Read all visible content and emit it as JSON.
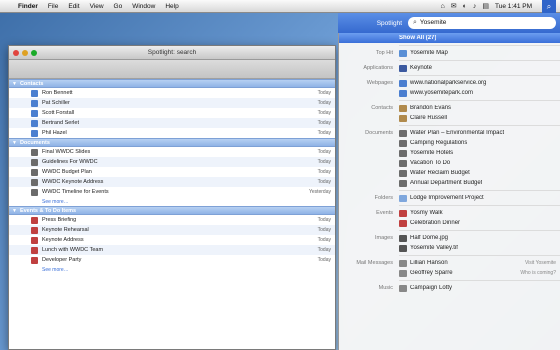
{
  "menubar": {
    "apple": "",
    "items": [
      "Finder",
      "File",
      "Edit",
      "View",
      "Go",
      "Window",
      "Help"
    ],
    "clock": "Tue 1:41 PM",
    "tray": [
      "⌂",
      "✉",
      "◐",
      "♪",
      "▤"
    ]
  },
  "spotlight": {
    "label": "Spotlight",
    "query": "Yosemite",
    "show_all": "Show All (27)",
    "groups": [
      {
        "category": "Top Hit",
        "items": [
          {
            "text": "Yosemite Map",
            "color": "#5a8fd6"
          }
        ]
      },
      {
        "category": "Applications",
        "items": [
          {
            "text": "Keynote",
            "color": "#3c5aa0"
          }
        ]
      },
      {
        "category": "Webpages",
        "items": [
          {
            "text": "www.nationalparkservice.org",
            "color": "#4b7fd0"
          },
          {
            "text": "www.yosemitepark.com",
            "color": "#4b7fd0"
          }
        ]
      },
      {
        "category": "Contacts",
        "items": [
          {
            "text": "Brandon Evans",
            "color": "#b08a4c"
          },
          {
            "text": "Claire Russell",
            "color": "#b08a4c"
          }
        ]
      },
      {
        "category": "Documents",
        "items": [
          {
            "text": "Water Plan – Environmental Impact",
            "color": "#6b6b6b"
          },
          {
            "text": "Camping Regulations",
            "color": "#6b6b6b"
          },
          {
            "text": "Yosemite Hotels",
            "color": "#6b6b6b"
          },
          {
            "text": "Vacation To Do",
            "color": "#6b6b6b"
          },
          {
            "text": "Water Reclaim Budget",
            "color": "#6b6b6b"
          },
          {
            "text": "Annual Department Budget",
            "color": "#6b6b6b"
          }
        ]
      },
      {
        "category": "Folders",
        "items": [
          {
            "text": "Lodge Improvement Project",
            "color": "#7fa7dd"
          }
        ]
      },
      {
        "category": "Events",
        "items": [
          {
            "text": "Yosmy Walk",
            "color": "#c04040"
          },
          {
            "text": "Celebration Dinner",
            "color": "#c04040"
          }
        ]
      },
      {
        "category": "Images",
        "items": [
          {
            "text": "Half Dome.jpg",
            "color": "#555"
          },
          {
            "text": "Yosemite Valley.tif",
            "color": "#555"
          }
        ]
      },
      {
        "category": "Mail Messages",
        "items": [
          {
            "text": "Lillian Hanson",
            "color": "#888",
            "meta": "Visit Yosemite"
          },
          {
            "text": "Geoffrey Sparre",
            "color": "#888",
            "meta": "Who is coming?"
          }
        ]
      },
      {
        "category": "Music",
        "items": [
          {
            "text": "Campaign Lotty",
            "color": "#888"
          }
        ]
      }
    ]
  },
  "window": {
    "title": "Spotlight: search",
    "groups": [
      {
        "name": "Contacts",
        "color": "#4b7fd0",
        "rows": [
          {
            "name": "Ron Bennett",
            "date": "Today"
          },
          {
            "name": "Pat Schiller",
            "date": "Today"
          },
          {
            "name": "Scott Forstall",
            "date": "Today"
          },
          {
            "name": "Bertrand Serlet",
            "date": "Today"
          },
          {
            "name": "Phil Hazel",
            "date": "Today"
          }
        ]
      },
      {
        "name": "Documents",
        "color": "#6b6b6b",
        "rows": [
          {
            "name": "Final WWDC Slides",
            "date": "Today"
          },
          {
            "name": "Guidelines For WWDC",
            "date": "Today"
          },
          {
            "name": "WWDC Budget Plan",
            "date": "Today"
          },
          {
            "name": "WWDC Keynote Address",
            "date": "Today"
          },
          {
            "name": "WWDC Timeline for Events",
            "date": "Yesterday"
          }
        ],
        "more": "See more…"
      },
      {
        "name": "Events & To Do Items",
        "color": "#c04040",
        "rows": [
          {
            "name": "Press Briefing",
            "date": "Today"
          },
          {
            "name": "Keynote Rehearsal",
            "date": "Today"
          },
          {
            "name": "Keynote Address",
            "date": "Today"
          },
          {
            "name": "Lunch with WWDC Team",
            "date": "Today"
          },
          {
            "name": "Developer Party",
            "date": "Today"
          }
        ],
        "more": "See more…"
      }
    ]
  }
}
